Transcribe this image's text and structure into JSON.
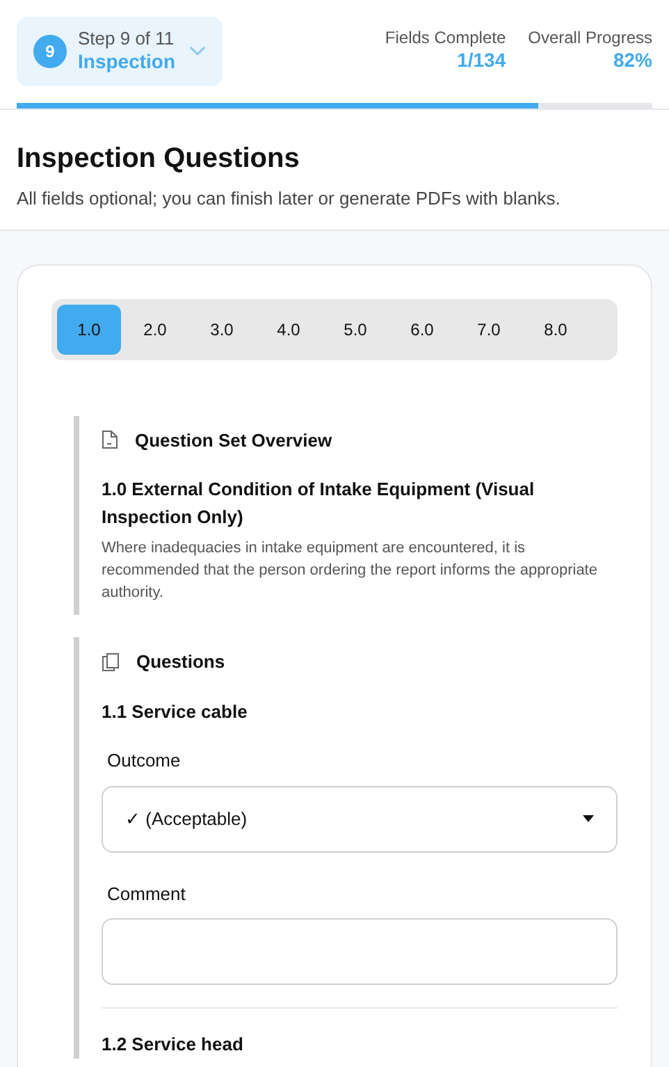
{
  "step": {
    "number": "9",
    "label": "Step 9 of 11",
    "name": "Inspection"
  },
  "stats": [
    {
      "label": "Fields Complete",
      "value": "1/134"
    },
    {
      "label": "Overall Progress",
      "value": "82%"
    }
  ],
  "progress": {
    "level": 0.82
  },
  "page": {
    "title": "Inspection Questions",
    "subtitle": "All fields optional; you can finish later or generate PDFs with blanks."
  },
  "tabs": [
    {
      "label": "1.0",
      "selected": true
    },
    {
      "label": "2.0",
      "selected": false
    },
    {
      "label": "3.0",
      "selected": false
    },
    {
      "label": "4.0",
      "selected": false
    },
    {
      "label": "5.0",
      "selected": false
    },
    {
      "label": "6.0",
      "selected": false
    },
    {
      "label": "7.0",
      "selected": false
    },
    {
      "label": "8.0",
      "selected": false
    }
  ],
  "overview": {
    "heading": "Question Set Overview",
    "title": "1.0 External Condition of Intake Equipment (Visual Inspection Only)",
    "description": "Where inadequacies in intake equipment are encountered, it is recommended that the person ordering the report informs the appropriate authority."
  },
  "questions_heading": "Questions",
  "questions": [
    {
      "title": "1.1 Service cable",
      "outcome_label": "Outcome",
      "outcome": "✓ (Acceptable)",
      "comment_label": "Comment"
    },
    {
      "title": "1.2 Service head"
    }
  ]
}
